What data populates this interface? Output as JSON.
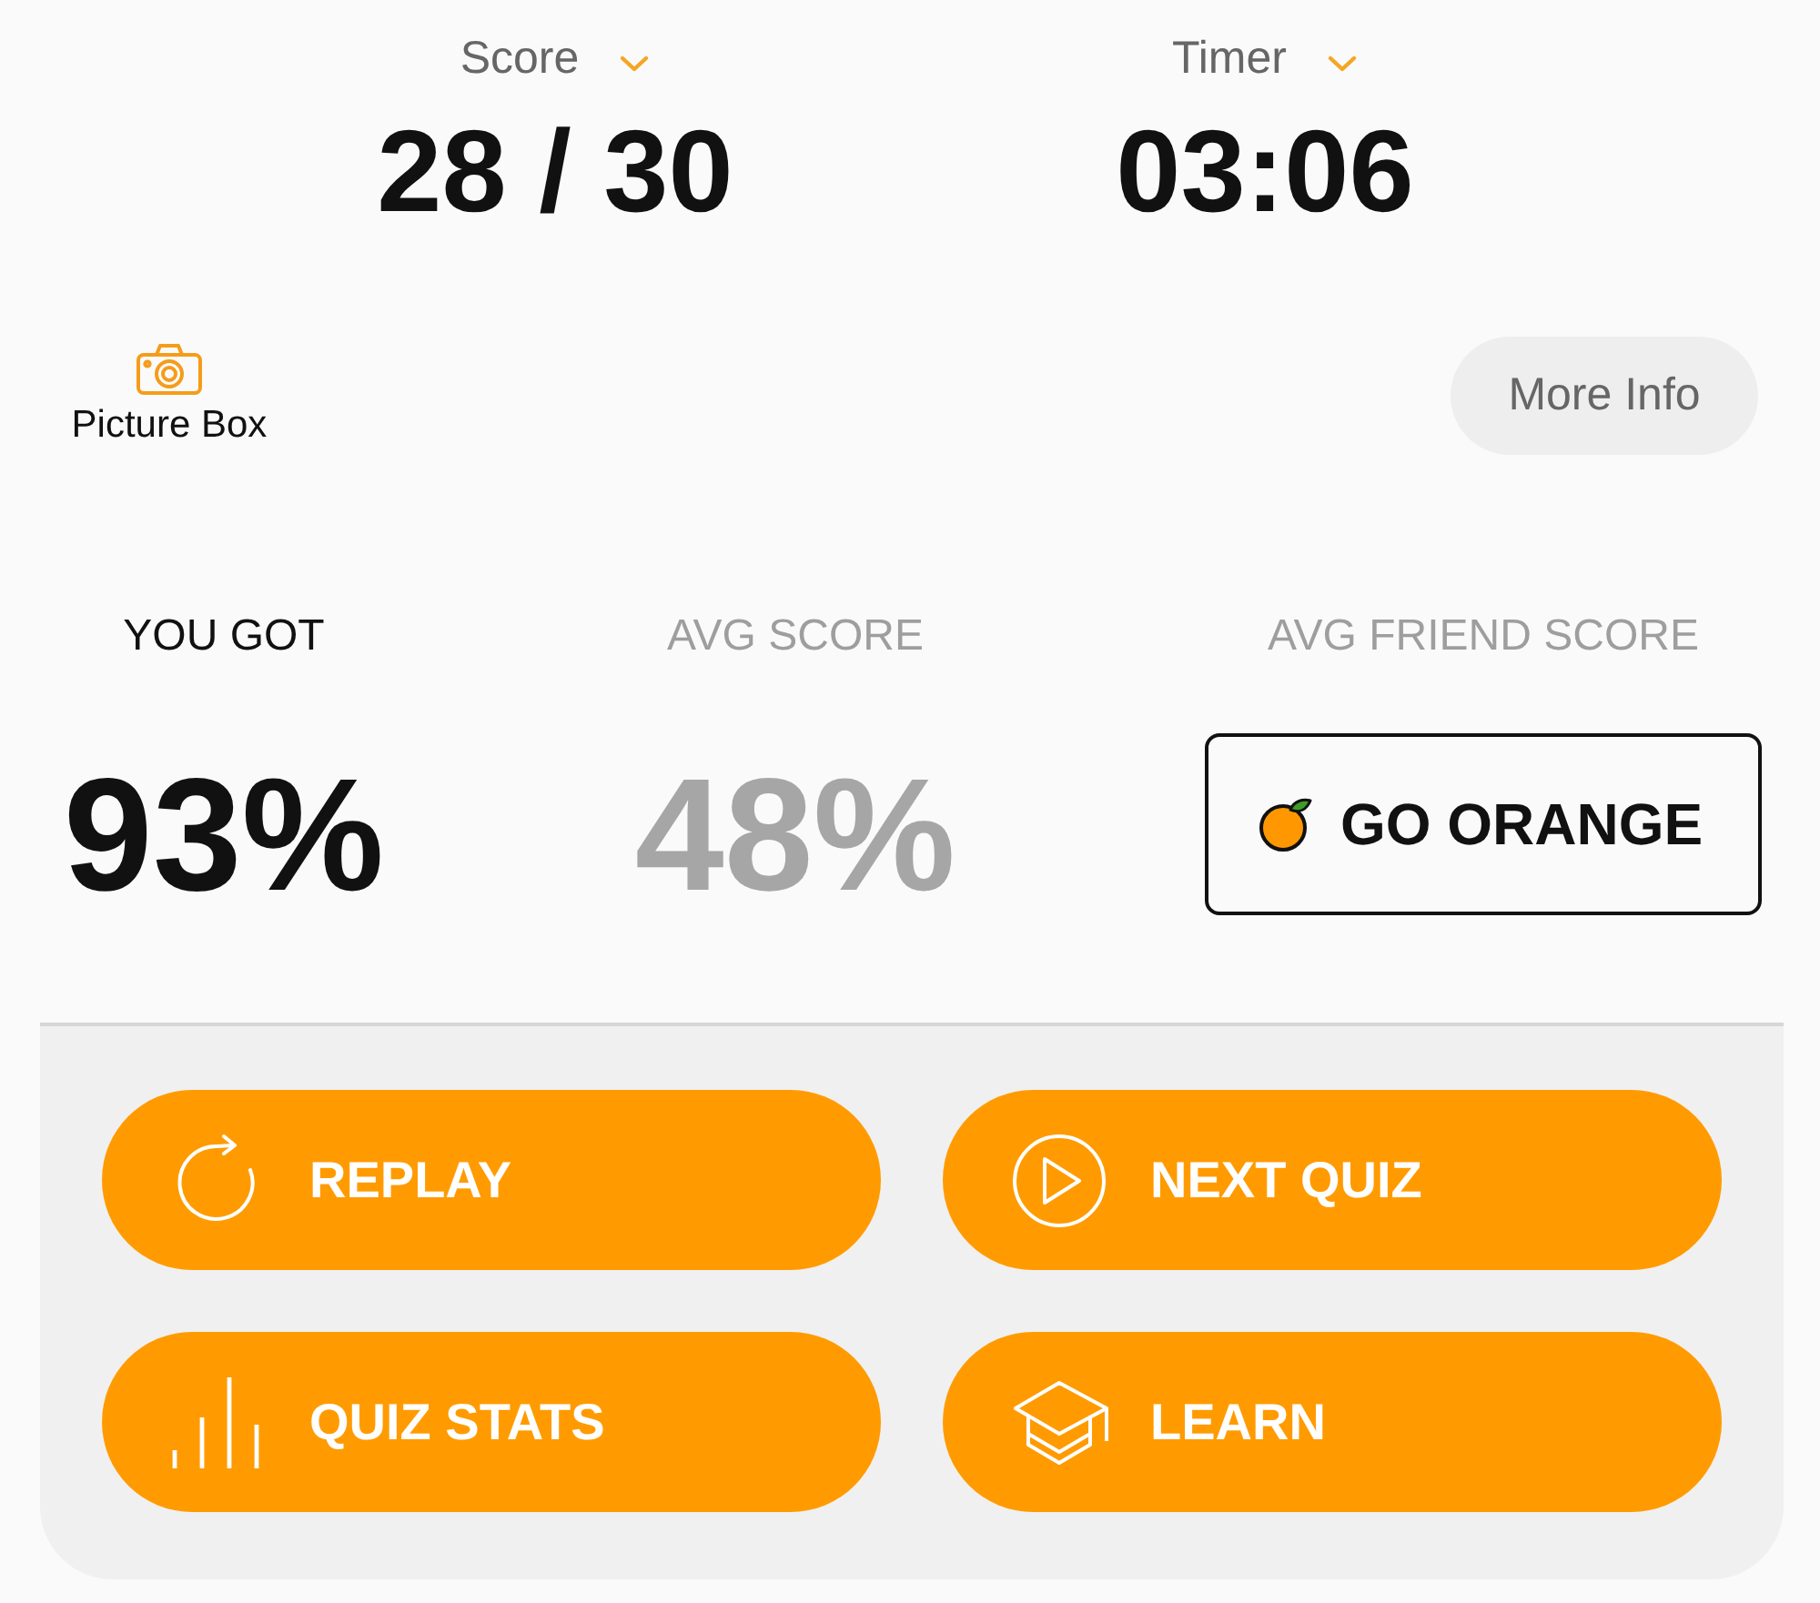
{
  "header": [
    {
      "label": "Score",
      "value": "28 / 30"
    },
    {
      "label": "Timer",
      "value": "03:06"
    }
  ],
  "picture_box": {
    "label": "Picture Box"
  },
  "more_info_button": {
    "label": "More Info"
  },
  "stats": [
    {
      "kind": "primary",
      "label": "YOU GOT",
      "value": "93%"
    },
    {
      "kind": "muted",
      "label": "AVG SCORE",
      "value": "48%"
    },
    {
      "kind": "action",
      "label": "AVG FRIEND SCORE",
      "button": "GO ORANGE"
    }
  ],
  "actions": [
    {
      "kind": "replay",
      "label": "REPLAY"
    },
    {
      "kind": "play",
      "label": "NEXT QUIZ"
    },
    {
      "kind": "chart",
      "label": "QUIZ STATS"
    },
    {
      "kind": "cap",
      "label": "LEARN"
    }
  ]
}
